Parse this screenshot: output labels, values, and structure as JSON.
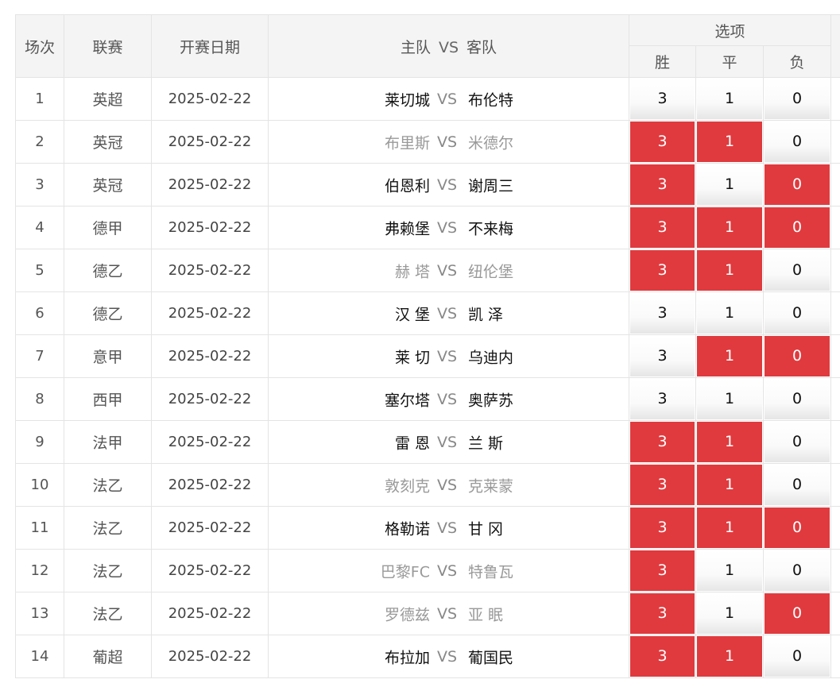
{
  "header": {
    "col_round": "场次",
    "col_league": "联赛",
    "col_date": "开赛日期",
    "col_home": "主队",
    "col_vs": "VS",
    "col_away": "客队",
    "col_options": "选项",
    "opt_win": "胜",
    "opt_draw": "平",
    "opt_lose": "负"
  },
  "colors": {
    "selected": "#e03a3e",
    "dim_team": "#999999"
  },
  "matches": [
    {
      "no": "1",
      "league": "英超",
      "date": "2025-02-22",
      "home": "莱切城",
      "vs": "VS",
      "away": "布伦特",
      "dim": false,
      "win": "3",
      "draw": "1",
      "lose": "0",
      "sel": [
        false,
        false,
        false
      ]
    },
    {
      "no": "2",
      "league": "英冠",
      "date": "2025-02-22",
      "home": "布里斯",
      "vs": "VS",
      "away": "米德尔",
      "dim": true,
      "win": "3",
      "draw": "1",
      "lose": "0",
      "sel": [
        true,
        true,
        false
      ]
    },
    {
      "no": "3",
      "league": "英冠",
      "date": "2025-02-22",
      "home": "伯恩利",
      "vs": "VS",
      "away": "谢周三",
      "dim": false,
      "win": "3",
      "draw": "1",
      "lose": "0",
      "sel": [
        true,
        false,
        true
      ]
    },
    {
      "no": "4",
      "league": "德甲",
      "date": "2025-02-22",
      "home": "弗赖堡",
      "vs": "VS",
      "away": "不来梅",
      "dim": false,
      "win": "3",
      "draw": "1",
      "lose": "0",
      "sel": [
        true,
        true,
        true
      ]
    },
    {
      "no": "5",
      "league": "德乙",
      "date": "2025-02-22",
      "home": "赫 塔",
      "vs": "VS",
      "away": "纽伦堡",
      "dim": true,
      "win": "3",
      "draw": "1",
      "lose": "0",
      "sel": [
        true,
        true,
        false
      ]
    },
    {
      "no": "6",
      "league": "德乙",
      "date": "2025-02-22",
      "home": "汉 堡",
      "vs": "VS",
      "away": "凯 泽",
      "dim": false,
      "win": "3",
      "draw": "1",
      "lose": "0",
      "sel": [
        false,
        false,
        false
      ]
    },
    {
      "no": "7",
      "league": "意甲",
      "date": "2025-02-22",
      "home": "莱 切",
      "vs": "VS",
      "away": "乌迪内",
      "dim": false,
      "win": "3",
      "draw": "1",
      "lose": "0",
      "sel": [
        false,
        true,
        true
      ]
    },
    {
      "no": "8",
      "league": "西甲",
      "date": "2025-02-22",
      "home": "塞尔塔",
      "vs": "VS",
      "away": "奥萨苏",
      "dim": false,
      "win": "3",
      "draw": "1",
      "lose": "0",
      "sel": [
        false,
        false,
        false
      ]
    },
    {
      "no": "9",
      "league": "法甲",
      "date": "2025-02-22",
      "home": "雷 恩",
      "vs": "VS",
      "away": "兰 斯",
      "dim": false,
      "win": "3",
      "draw": "1",
      "lose": "0",
      "sel": [
        true,
        true,
        false
      ]
    },
    {
      "no": "10",
      "league": "法乙",
      "date": "2025-02-22",
      "home": "敦刻克",
      "vs": "VS",
      "away": "克莱蒙",
      "dim": true,
      "win": "3",
      "draw": "1",
      "lose": "0",
      "sel": [
        true,
        true,
        false
      ]
    },
    {
      "no": "11",
      "league": "法乙",
      "date": "2025-02-22",
      "home": "格勒诺",
      "vs": "VS",
      "away": "甘 冈",
      "dim": false,
      "win": "3",
      "draw": "1",
      "lose": "0",
      "sel": [
        true,
        true,
        true
      ]
    },
    {
      "no": "12",
      "league": "法乙",
      "date": "2025-02-22",
      "home": "巴黎FC",
      "vs": "VS",
      "away": "特鲁瓦",
      "dim": true,
      "win": "3",
      "draw": "1",
      "lose": "0",
      "sel": [
        true,
        false,
        false
      ]
    },
    {
      "no": "13",
      "league": "法乙",
      "date": "2025-02-22",
      "home": "罗德兹",
      "vs": "VS",
      "away": "亚 眠",
      "dim": true,
      "win": "3",
      "draw": "1",
      "lose": "0",
      "sel": [
        true,
        false,
        true
      ]
    },
    {
      "no": "14",
      "league": "葡超",
      "date": "2025-02-22",
      "home": "布拉加",
      "vs": "VS",
      "away": "葡国民",
      "dim": false,
      "win": "3",
      "draw": "1",
      "lose": "0",
      "sel": [
        true,
        true,
        false
      ]
    }
  ]
}
